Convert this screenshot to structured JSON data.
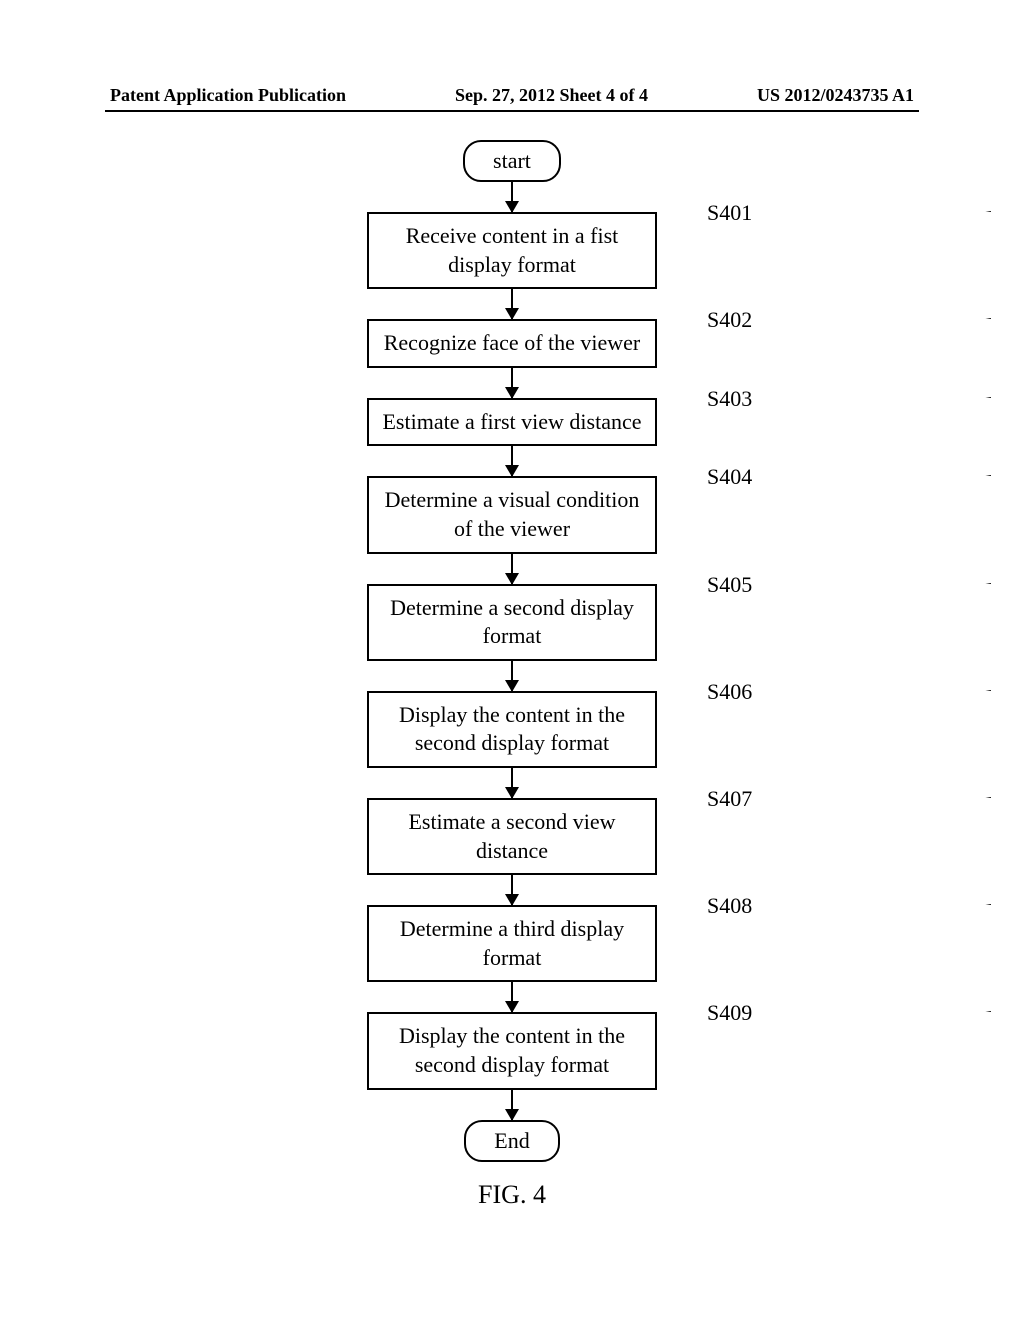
{
  "header": {
    "left": "Patent Application Publication",
    "center": "Sep. 27, 2012  Sheet 4 of 4",
    "right": "US 2012/0243735 A1"
  },
  "flowchart": {
    "start": "start",
    "end": "End",
    "steps": [
      {
        "label": "S401",
        "text": "Receive content in a fist display format"
      },
      {
        "label": "S402",
        "text": "Recognize face of the viewer"
      },
      {
        "label": "S403",
        "text": "Estimate a first view distance"
      },
      {
        "label": "S404",
        "text": "Determine a visual condition of the viewer"
      },
      {
        "label": "S405",
        "text": "Determine a second display format"
      },
      {
        "label": "S406",
        "text": "Display the content in the second display format"
      },
      {
        "label": "S407",
        "text": "Estimate a second view distance"
      },
      {
        "label": "S408",
        "text": "Determine a third display format"
      },
      {
        "label": "S409",
        "text": "Display the content in the second display format"
      }
    ]
  },
  "caption": "FIG. 4"
}
